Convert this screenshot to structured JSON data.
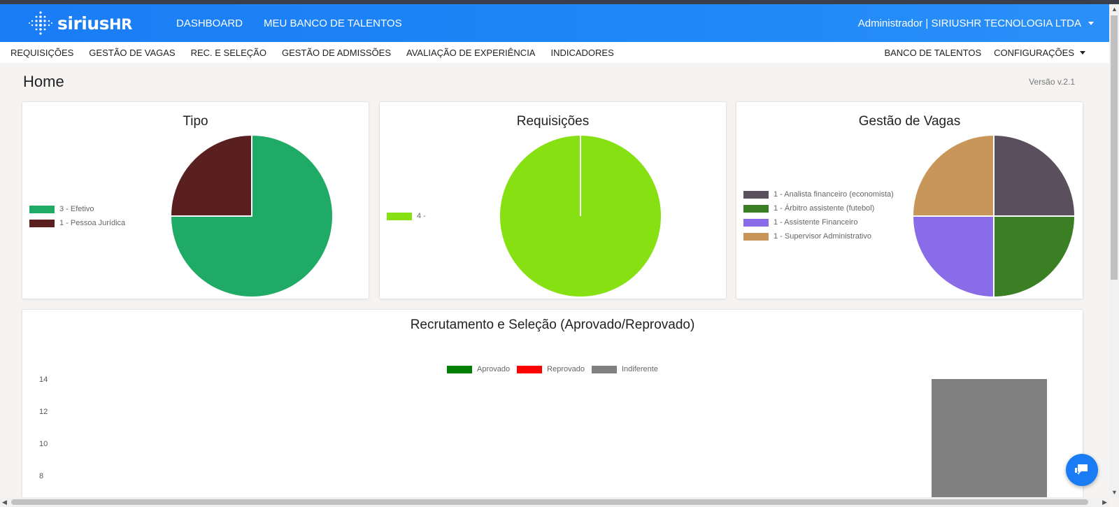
{
  "app": {
    "logo_text": "sirius",
    "logo_suffix": "HR"
  },
  "topnav": {
    "items": [
      "DASHBOARD",
      "MEU BANCO DE TALENTOS"
    ],
    "user": "Administrador | SIRIUSHR TECNOLOGIA LTDA"
  },
  "subnav": {
    "left": [
      "REQUISIÇÕES",
      "GESTÃO DE VAGAS",
      "REC. E SELEÇÃO",
      "GESTÃO DE ADMISSÕES",
      "AVALIAÇÃO DE EXPERIÊNCIA",
      "INDICADORES"
    ],
    "right": [
      "BANCO DE TALENTOS",
      "CONFIGURAÇÕES"
    ]
  },
  "page": {
    "title": "Home",
    "version": "Versão v.2.1"
  },
  "colors": {
    "topbar": "#1a7cf5",
    "efetivo": "#1faa66",
    "pj": "#5a2020",
    "req": "#86e012",
    "analista": "#5a4f5c",
    "arbitro": "#3a7f24",
    "assistente": "#8a6be8",
    "supervisor": "#c9965a",
    "aprovado": "#008000",
    "reprovado": "#ff0000",
    "indiferente": "#808080"
  },
  "chart_data": [
    {
      "type": "pie",
      "title": "Tipo",
      "legend": [
        "3 - Efetivo",
        "1 - Pessoa Jurídica"
      ],
      "values": [
        3,
        1
      ],
      "colors": [
        "#1faa66",
        "#5a2020"
      ]
    },
    {
      "type": "pie",
      "title": "Requisições",
      "legend": [
        "4 -"
      ],
      "values": [
        4
      ],
      "colors": [
        "#86e012"
      ]
    },
    {
      "type": "pie",
      "title": "Gestão de Vagas",
      "legend": [
        "1 - Analista financeiro (economista)",
        "1 - Árbitro assistente (futebol)",
        "1 - Assistente Financeiro",
        "1 - Supervisor Administrativo"
      ],
      "values": [
        1,
        1,
        1,
        1
      ],
      "colors": [
        "#5a4f5c",
        "#3a7f24",
        "#8a6be8",
        "#c9965a"
      ]
    },
    {
      "type": "bar",
      "title": "Recrutamento e Seleção (Aprovado/Reprovado)",
      "series": [
        {
          "name": "Aprovado",
          "values": [
            0
          ],
          "color": "#008000"
        },
        {
          "name": "Reprovado",
          "values": [
            0
          ],
          "color": "#ff0000"
        },
        {
          "name": "Indiferente",
          "values": [
            14
          ],
          "color": "#808080"
        }
      ],
      "yticks": [
        "14",
        "12",
        "10",
        "8"
      ],
      "ylim": [
        0,
        14
      ]
    }
  ]
}
